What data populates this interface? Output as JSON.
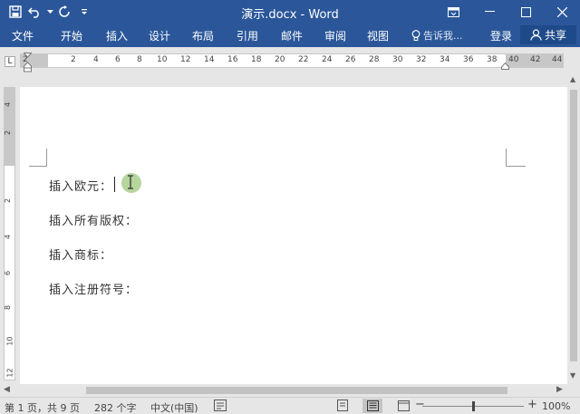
{
  "window": {
    "title": "演示.docx - Word"
  },
  "ribbon": {
    "tabs": [
      {
        "label": "文件"
      },
      {
        "label": "开始"
      },
      {
        "label": "插入"
      },
      {
        "label": "设计"
      },
      {
        "label": "布局"
      },
      {
        "label": "引用"
      },
      {
        "label": "邮件"
      },
      {
        "label": "审阅"
      },
      {
        "label": "视图"
      }
    ],
    "tell_me": "告诉我...",
    "login": "登录",
    "share": "共享"
  },
  "ruler": {
    "corner": "L",
    "numbers": [
      "2",
      "2",
      "4",
      "6",
      "8",
      "10",
      "12",
      "14",
      "16",
      "18",
      "20",
      "22",
      "24",
      "26",
      "28",
      "30",
      "32",
      "34",
      "36",
      "38",
      "40",
      "42",
      "44"
    ],
    "vertical_numbers": [
      "4",
      "2",
      "2",
      "4",
      "6",
      "8",
      "10",
      "12"
    ]
  },
  "document": {
    "lines": [
      "插入欧元：",
      "插入所有版权：",
      "插入商标：",
      "插入注册符号："
    ]
  },
  "statusbar": {
    "page": "第 1 页，共 9 页",
    "words": "282 个字",
    "language": "中文(中国)",
    "zoom": "100%",
    "zoom_minus": "−",
    "zoom_plus": "+"
  },
  "icons": {
    "save": "save-icon",
    "undo": "undo-icon",
    "redo": "redo-icon",
    "customize": "customize-qat-icon",
    "ribbon_display": "ribbon-display-options-icon",
    "minimize": "minimize-icon",
    "restore": "restore-icon",
    "close": "close-icon",
    "lightbulb": "lightbulb-icon",
    "user": "user-icon",
    "proofing": "proofing-icon",
    "macro": "macro-icon"
  },
  "colors": {
    "accent": "#2b579a",
    "share_bg": "#1e4a89",
    "click_highlight": "#b5d69c"
  }
}
